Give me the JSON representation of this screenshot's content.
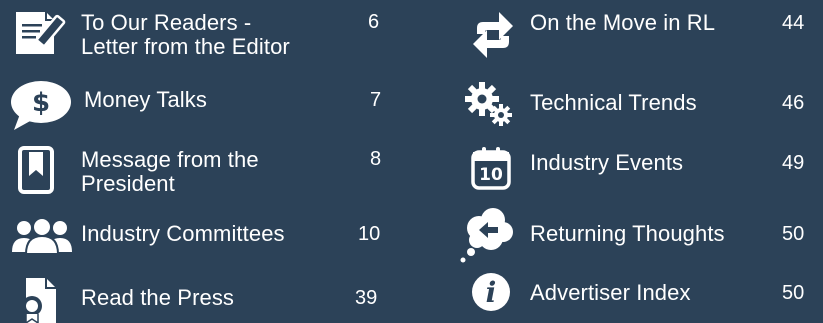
{
  "toc": {
    "left": [
      {
        "icon": "pencil-document-icon",
        "title": "To Our Readers -\nLetter from the Editor",
        "page": "6"
      },
      {
        "icon": "dollar-speech-bubble-icon",
        "title": "Money Talks",
        "page": "7"
      },
      {
        "icon": "bookmark-icon",
        "title": "Message from the\nPresident",
        "page": "8"
      },
      {
        "icon": "group-people-icon",
        "title": "Industry Committees",
        "page": "10"
      },
      {
        "icon": "press-document-icon",
        "title": "Read the Press",
        "page": "39"
      }
    ],
    "right": [
      {
        "icon": "move-arrows-icon",
        "title": "On the Move in RL",
        "page": "44"
      },
      {
        "icon": "gears-icon",
        "title": "Technical Trends",
        "page": "46"
      },
      {
        "icon": "calendar-icon",
        "title": "Industry Events",
        "page": "49",
        "calendar_day": "10"
      },
      {
        "icon": "thought-bubble-icon",
        "title": "Returning Thoughts",
        "page": "50"
      },
      {
        "icon": "info-icon",
        "title": "Advertiser Index",
        "page": "50"
      }
    ]
  },
  "colors": {
    "background": "#2c4258",
    "foreground": "#ffffff"
  }
}
